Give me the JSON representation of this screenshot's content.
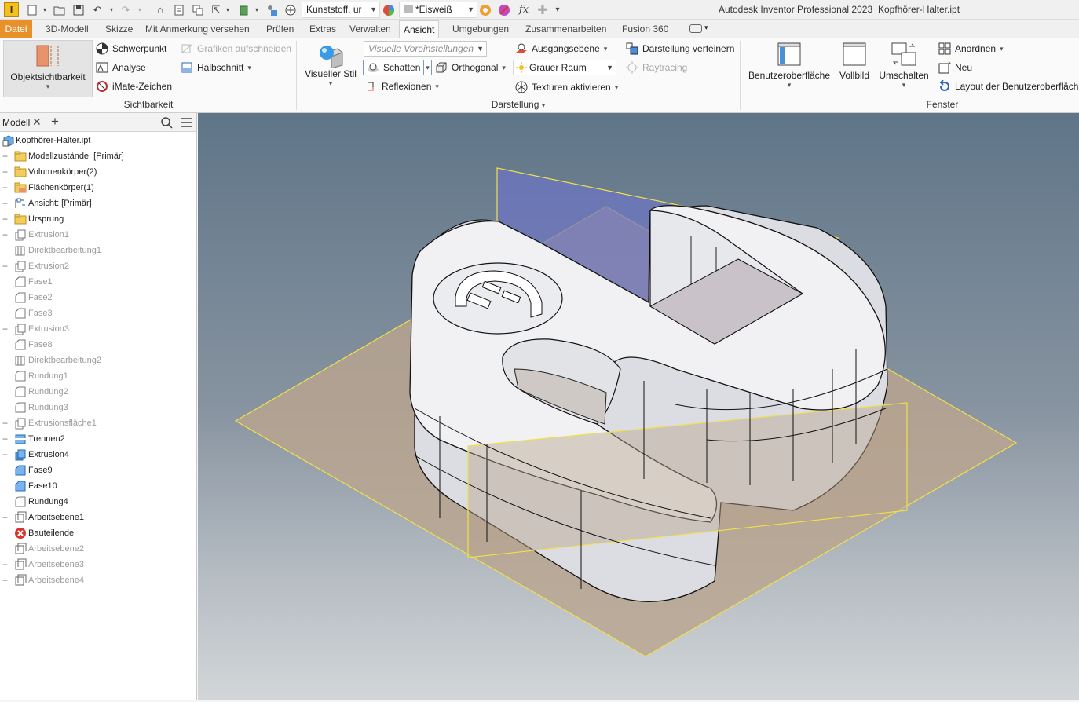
{
  "app": {
    "logo": "I",
    "title": "Autodesk Inventor Professional 2023",
    "file": "Kopfhörer-Halter.ipt"
  },
  "qat": {
    "material": "Kunststoff, ur",
    "appearance": "*Eisweiß",
    "fx": "fx"
  },
  "tabs": [
    "Datei",
    "3D-Modell",
    "Skizze",
    "Mit Anmerkung versehen",
    "Prüfen",
    "Extras",
    "Verwalten",
    "Ansicht",
    "Umgebungen",
    "Zusammenarbeiten",
    "Fusion 360"
  ],
  "active_tab": "Ansicht",
  "ribbon": {
    "sichtbarkeit": {
      "label": "Sichtbarkeit",
      "objektsichtbarkeit": "Objektsichtbarkeit",
      "schwerpunkt": "Schwerpunkt",
      "analyse": "Analyse",
      "imate": "iMate-Zeichen",
      "grafiken": "Grafiken aufschneiden",
      "halbschnitt": "Halbschnitt"
    },
    "darstellung": {
      "label": "Darstellung",
      "visueller_stil": "Visueller Stil",
      "voreinstellungen": "Visuelle Voreinstellungen",
      "schatten": "Schatten",
      "orthogonal": "Orthogonal",
      "reflexionen": "Reflexionen",
      "ausgangsebene": "Ausgangsebene",
      "grauer_raum": "Grauer Raum",
      "texturen": "Texturen aktivieren",
      "verfeinern": "Darstellung verfeinern",
      "raytracing": "Raytracing"
    },
    "fenster": {
      "label": "Fenster",
      "benutzeroberflaeche": "Benutzeroberfläche",
      "vollbild": "Vollbild",
      "umschalten": "Umschalten",
      "anordnen": "Anordnen",
      "neu": "Neu",
      "layout": "Layout der Benutzeroberfläche"
    }
  },
  "browser": {
    "tab": "Modell",
    "root": "Kopfhörer-Halter.ipt",
    "items": [
      {
        "label": "Modellzustände: [Primär]",
        "icon": "folder-icon",
        "exp": true,
        "dim": false
      },
      {
        "label": "Volumenkörper(2)",
        "icon": "folder-icon",
        "exp": true,
        "dim": false
      },
      {
        "label": "Flächenkörper(1)",
        "icon": "surface-folder-icon",
        "exp": true,
        "dim": false
      },
      {
        "label": "Ansicht: [Primär]",
        "icon": "view-icon",
        "exp": true,
        "dim": false
      },
      {
        "label": "Ursprung",
        "icon": "folder-icon",
        "exp": true,
        "dim": false
      },
      {
        "label": "Extrusion1",
        "icon": "extrude-icon",
        "exp": true,
        "dim": true
      },
      {
        "label": "Direktbearbeitung1",
        "icon": "direct-edit-icon",
        "exp": false,
        "dim": true
      },
      {
        "label": "Extrusion2",
        "icon": "extrude-icon",
        "exp": true,
        "dim": true
      },
      {
        "label": "Fase1",
        "icon": "chamfer-icon",
        "exp": false,
        "dim": true
      },
      {
        "label": "Fase2",
        "icon": "chamfer-icon",
        "exp": false,
        "dim": true
      },
      {
        "label": "Fase3",
        "icon": "chamfer-icon",
        "exp": false,
        "dim": true
      },
      {
        "label": "Extrusion3",
        "icon": "extrude-icon",
        "exp": true,
        "dim": true
      },
      {
        "label": "Fase8",
        "icon": "chamfer-icon",
        "exp": false,
        "dim": true
      },
      {
        "label": "Direktbearbeitung2",
        "icon": "direct-edit-icon",
        "exp": false,
        "dim": true
      },
      {
        "label": "Rundung1",
        "icon": "fillet-icon",
        "exp": false,
        "dim": true
      },
      {
        "label": "Rundung2",
        "icon": "fillet-icon",
        "exp": false,
        "dim": true
      },
      {
        "label": "Rundung3",
        "icon": "fillet-icon",
        "exp": false,
        "dim": true
      },
      {
        "label": "Extrusionsfläche1",
        "icon": "extrude-icon",
        "exp": true,
        "dim": true
      },
      {
        "label": "Trennen2",
        "icon": "split-icon",
        "exp": true,
        "dim": false
      },
      {
        "label": "Extrusion4",
        "icon": "extrude-blue-icon",
        "exp": true,
        "dim": false
      },
      {
        "label": "Fase9",
        "icon": "chamfer-blue-icon",
        "exp": false,
        "dim": false
      },
      {
        "label": "Fase10",
        "icon": "chamfer-blue-icon",
        "exp": false,
        "dim": false
      },
      {
        "label": "Rundung4",
        "icon": "fillet-icon",
        "exp": false,
        "dim": false
      },
      {
        "label": "Arbeitsebene1",
        "icon": "workplane-icon",
        "exp": true,
        "dim": false
      },
      {
        "label": "Bauteilende",
        "icon": "end-of-part-icon",
        "exp": false,
        "dim": false
      },
      {
        "label": "Arbeitsebene2",
        "icon": "workplane-icon",
        "exp": false,
        "dim": true
      },
      {
        "label": "Arbeitsebene3",
        "icon": "workplane-icon",
        "exp": true,
        "dim": true
      },
      {
        "label": "Arbeitsebene4",
        "icon": "workplane-icon",
        "exp": true,
        "dim": true
      }
    ]
  },
  "colors": {
    "accent": "#e8912a",
    "plane_yellow": "#f0e14a",
    "plane_tan": "#b9a58f",
    "plane_blue": "#6c75c5"
  }
}
